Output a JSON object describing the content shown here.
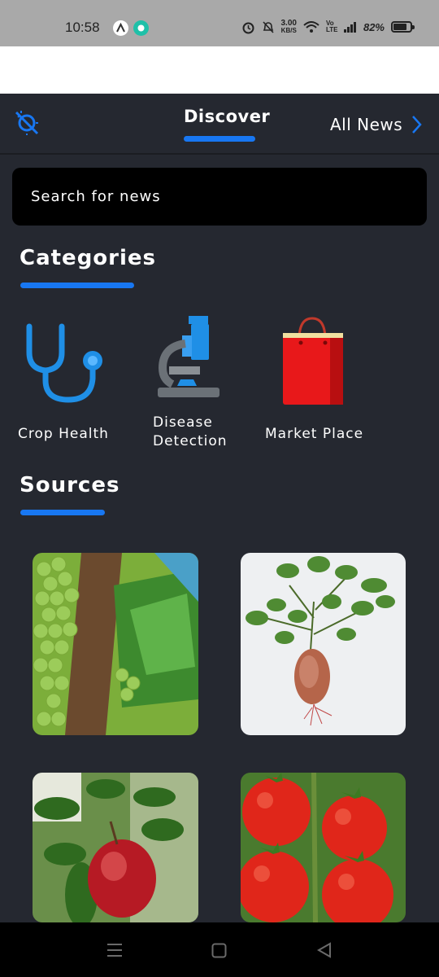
{
  "status_bar": {
    "time": "10:58",
    "speed_value": "3.00",
    "speed_unit": "KB/S",
    "volte": "Vo LTE",
    "battery_pct": "82%",
    "battery_level": 0.82,
    "icons": [
      "alarm-icon",
      "bell-off-icon",
      "wifi-icon",
      "signal-icon",
      "battery-icon"
    ]
  },
  "header": {
    "active_tab": "Discover",
    "all_news_label": "All News",
    "accent": "#1877f2"
  },
  "search": {
    "placeholder": "Search for news"
  },
  "categories": {
    "title": "Categories",
    "items": [
      {
        "label": "Crop Health",
        "icon": "stethoscope-icon"
      },
      {
        "label_line1": "Disease",
        "label_line2": "Detection",
        "icon": "microscope-icon"
      },
      {
        "label": "Market Place",
        "icon": "shopping-bag-icon"
      }
    ]
  },
  "sources": {
    "title": "Sources",
    "tiles": [
      "grapes-image",
      "sweet-potato-image",
      "apple-image",
      "tomatoes-image"
    ]
  },
  "nav_bar": {
    "icons": [
      "menu-icon",
      "home-square-icon",
      "back-triangle-icon"
    ]
  }
}
